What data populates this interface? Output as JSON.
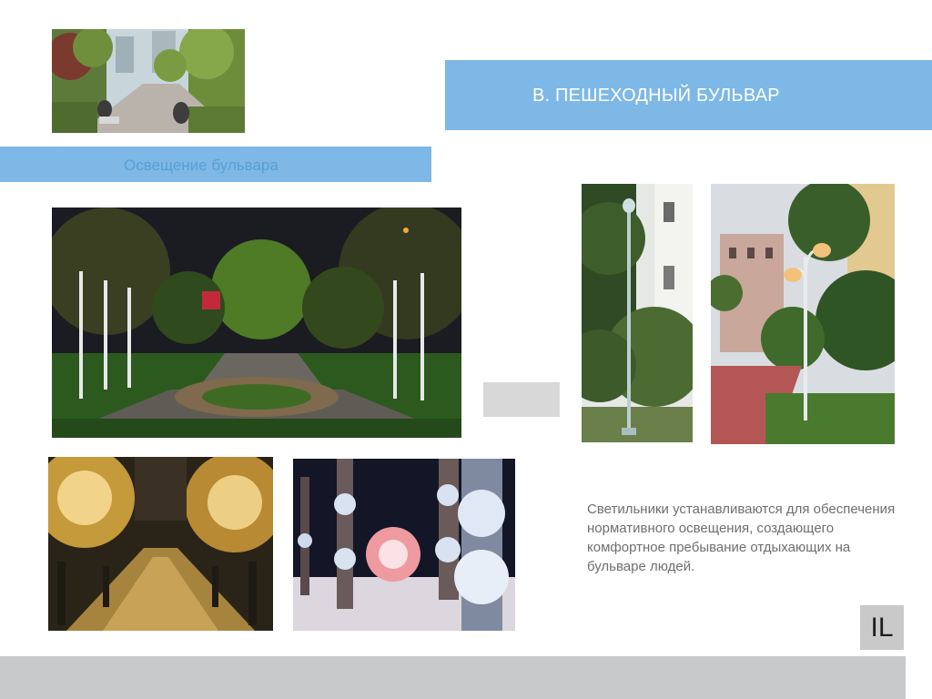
{
  "slide": {
    "title": "В. ПЕШЕХОДНЫЙ БУЛЬВАР",
    "subtitle": "Освещение бульвара",
    "description": "Светильники устанавливаются для обеспечения нормативного освещения, создающего комфортное пребывание отдыхающих на бульваре людей.",
    "logo_text": "IL"
  },
  "colors": {
    "banner": "#7db8e6",
    "subtitle_text": "#5a9fd6",
    "description_text": "#6f6f6f",
    "footer": "#c8c9cb"
  },
  "images": [
    {
      "name": "boulevard-daytime-photo"
    },
    {
      "name": "boulevard-night-lighting-photo"
    },
    {
      "name": "single-lamp-post-photo"
    },
    {
      "name": "double-lantern-lamp-post-photo"
    },
    {
      "name": "festive-lit-trees-street-photo"
    },
    {
      "name": "winter-lit-trees-photo"
    }
  ]
}
